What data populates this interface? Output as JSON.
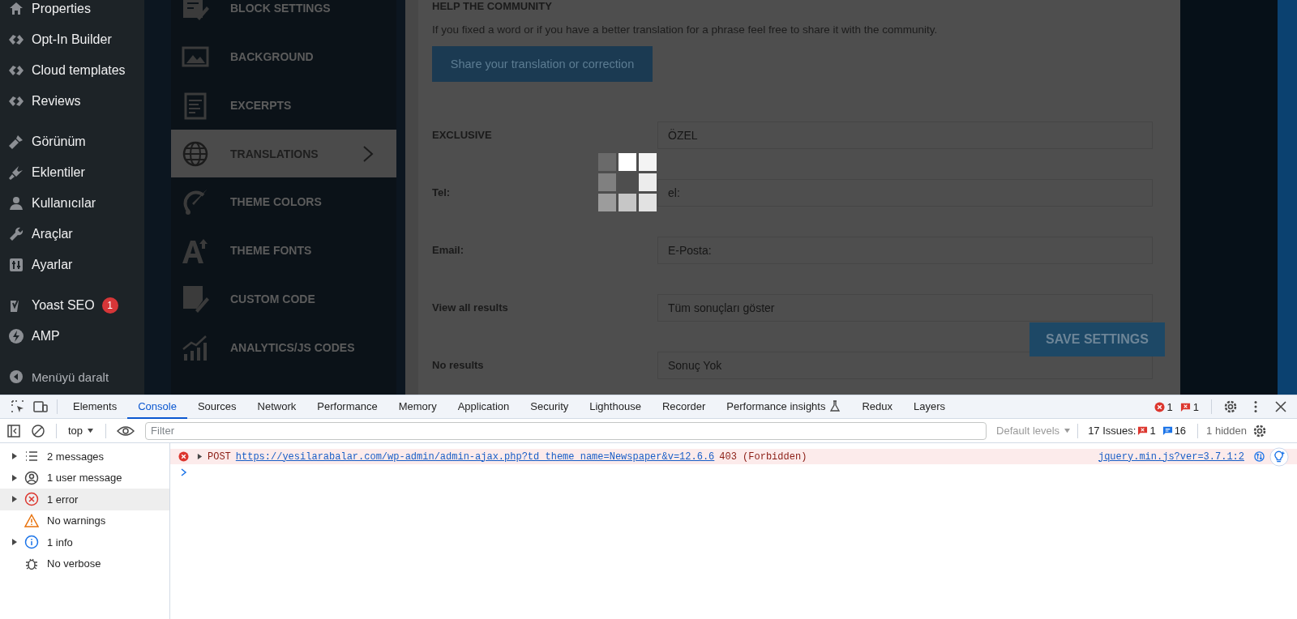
{
  "wp_sidebar": {
    "groups": [
      [
        {
          "label": "Properties"
        },
        {
          "label": "Opt-In Builder"
        },
        {
          "label": "Cloud templates"
        },
        {
          "label": "Reviews"
        }
      ],
      [
        {
          "label": "Görünüm"
        },
        {
          "label": "Eklentiler"
        },
        {
          "label": "Kullanıcılar"
        },
        {
          "label": "Araçlar"
        },
        {
          "label": "Ayarlar"
        }
      ],
      [
        {
          "label": "Yoast SEO",
          "badge": "1"
        },
        {
          "label": "AMP"
        }
      ]
    ],
    "collapse_label": "Menüyü daralt"
  },
  "settings_menu": {
    "items": [
      {
        "label": "BLOCK SETTINGS",
        "selected": false
      },
      {
        "label": "BACKGROUND",
        "selected": false
      },
      {
        "label": "EXCERPTS",
        "selected": false
      },
      {
        "label": "TRANSLATIONS",
        "selected": true
      },
      {
        "label": "THEME COLORS",
        "selected": false
      },
      {
        "label": "THEME FONTS",
        "selected": false
      },
      {
        "label": "CUSTOM CODE",
        "selected": false
      },
      {
        "label": "ANALYTICS/JS CODES",
        "selected": false
      }
    ]
  },
  "translations": {
    "title": "HELP THE COMMUNITY",
    "description": "If you fixed a word or if you have a better translation for a phrase feel free to share it with the community.",
    "share_button": "Share your translation or correction",
    "fields": [
      {
        "label": "EXCLUSIVE",
        "value": "ÖZEL"
      },
      {
        "label": "Tel:",
        "value": "el:"
      },
      {
        "label": "Email:",
        "value": "E-Posta:"
      },
      {
        "label": "View all results",
        "value": "Tüm sonuçları göster"
      },
      {
        "label": "No results",
        "value": "Sonuç Yok"
      }
    ],
    "save_button": "SAVE SETTINGS",
    "loading": true
  },
  "devtools": {
    "tabs": [
      {
        "label": "Elements",
        "selected": false,
        "experimental": false
      },
      {
        "label": "Console",
        "selected": true,
        "experimental": false
      },
      {
        "label": "Sources",
        "selected": false,
        "experimental": false
      },
      {
        "label": "Network",
        "selected": false,
        "experimental": false
      },
      {
        "label": "Performance",
        "selected": false,
        "experimental": false
      },
      {
        "label": "Memory",
        "selected": false,
        "experimental": false
      },
      {
        "label": "Application",
        "selected": false,
        "experimental": false
      },
      {
        "label": "Security",
        "selected": false,
        "experimental": false
      },
      {
        "label": "Lighthouse",
        "selected": false,
        "experimental": false
      },
      {
        "label": "Recorder",
        "selected": false,
        "experimental": false
      },
      {
        "label": "Performance insights",
        "selected": false,
        "experimental": true
      },
      {
        "label": "Redux",
        "selected": false,
        "experimental": false
      },
      {
        "label": "Layers",
        "selected": false,
        "experimental": false
      }
    ],
    "error_count": "1",
    "issue_count": "1",
    "toolbar": {
      "context": "top",
      "filter_placeholder": "Filter",
      "levels": "Default levels",
      "issues_label": "17 Issues:",
      "issue_errors": "1",
      "issue_infos": "16",
      "hidden": "1 hidden"
    },
    "sidebar": [
      {
        "label": "2 messages",
        "expandable": true,
        "selected": false
      },
      {
        "label": "1 user message",
        "expandable": true,
        "selected": false
      },
      {
        "label": "1 error",
        "expandable": true,
        "selected": true
      },
      {
        "label": "No warnings",
        "expandable": false,
        "selected": false
      },
      {
        "label": "1 info",
        "expandable": true,
        "selected": false
      },
      {
        "label": "No verbose",
        "expandable": false,
        "selected": false
      }
    ],
    "messages": [
      {
        "kind": "error",
        "method": "POST",
        "url": "https://yesilarabalar.com/wp-admin/admin-ajax.php?td_theme_name=Newspaper&v=12.6.6",
        "status": "403 (Forbidden)",
        "source": "jquery.min.js?ver=3.7.1:2"
      }
    ]
  }
}
